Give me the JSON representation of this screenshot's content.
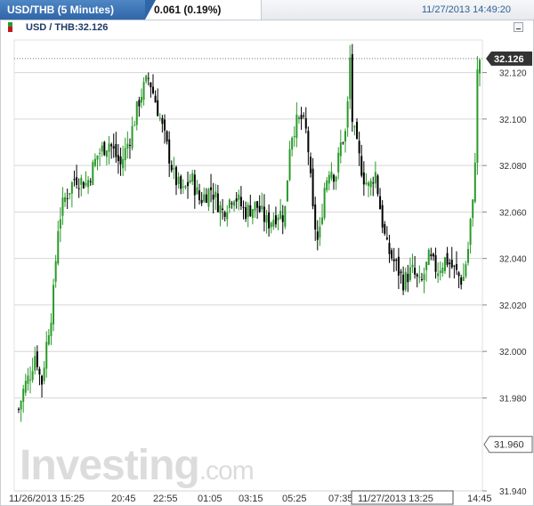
{
  "header": {
    "title": "USD/THB (5 Minutes)",
    "change": "0.061 (0.19%)",
    "timestamp": "11/27/2013 14:49:20"
  },
  "legend": {
    "text": "USD / THB:32.126"
  },
  "watermark": {
    "brand": "Investing",
    "domain": ".com"
  },
  "colors": {
    "up": "#2a9a2a",
    "down": "#000000",
    "grid": "#d6d6d6",
    "price_tag": "#333333"
  },
  "chart_data": {
    "type": "candlestick",
    "ylim": [
      31.94,
      32.134
    ],
    "yticks": [
      32.12,
      32.1,
      32.08,
      32.06,
      32.04,
      32.02,
      32.0,
      31.98,
      31.94
    ],
    "ytick_labels": [
      "32.120",
      "32.100",
      "32.080",
      "32.060",
      "32.040",
      "32.020",
      "32.000",
      "31.980",
      "31.940"
    ],
    "last_price": 32.126,
    "last_price_label": "32.126",
    "low_marker": 31.96,
    "low_marker_label": "31.960",
    "xtick_labels": [
      "11/26/2013 15:25",
      "20:45",
      "22:55",
      "01:05",
      "03:15",
      "05:25",
      "07:35",
      "11/27/2013 13:25",
      "14:45"
    ],
    "highlighted_xtick": "11/27/2013 13:25",
    "close_path": [
      [
        0,
        31.975
      ],
      [
        2,
        31.985
      ],
      [
        4,
        31.99
      ],
      [
        6,
        32.0
      ],
      [
        8,
        31.985
      ],
      [
        10,
        32.005
      ],
      [
        12,
        32.02
      ],
      [
        14,
        32.055
      ],
      [
        16,
        32.065
      ],
      [
        18,
        32.07
      ],
      [
        20,
        32.075
      ],
      [
        24,
        32.072
      ],
      [
        28,
        32.085
      ],
      [
        32,
        32.09
      ],
      [
        36,
        32.08
      ],
      [
        40,
        32.095
      ],
      [
        43,
        32.11
      ],
      [
        46,
        32.118
      ],
      [
        49,
        32.105
      ],
      [
        52,
        32.09
      ],
      [
        55,
        32.075
      ],
      [
        58,
        32.068
      ],
      [
        61,
        32.075
      ],
      [
        64,
        32.065
      ],
      [
        68,
        32.07
      ],
      [
        72,
        32.06
      ],
      [
        76,
        32.068
      ],
      [
        80,
        32.06
      ],
      [
        84,
        32.063
      ],
      [
        88,
        32.055
      ],
      [
        92,
        32.06
      ],
      [
        94,
        32.058
      ],
      [
        96,
        32.092
      ],
      [
        98,
        32.098
      ],
      [
        100,
        32.1
      ],
      [
        102,
        32.093
      ],
      [
        104,
        32.06
      ],
      [
        106,
        32.045
      ],
      [
        108,
        32.07
      ],
      [
        110,
        32.08
      ],
      [
        112,
        32.075
      ],
      [
        114,
        32.09
      ],
      [
        116,
        32.095
      ],
      [
        117,
        32.13
      ],
      [
        118,
        32.098
      ],
      [
        120,
        32.085
      ],
      [
        122,
        32.075
      ],
      [
        124,
        32.07
      ],
      [
        126,
        32.078
      ],
      [
        128,
        32.06
      ],
      [
        130,
        32.045
      ],
      [
        133,
        32.038
      ],
      [
        136,
        32.03
      ],
      [
        139,
        32.035
      ],
      [
        142,
        32.028
      ],
      [
        145,
        32.04
      ],
      [
        148,
        32.035
      ],
      [
        151,
        32.04
      ],
      [
        154,
        32.035
      ],
      [
        157,
        32.03
      ],
      [
        159,
        32.045
      ],
      [
        160,
        32.06
      ],
      [
        161,
        32.065
      ],
      [
        162,
        32.118
      ],
      [
        163,
        32.126
      ]
    ]
  }
}
